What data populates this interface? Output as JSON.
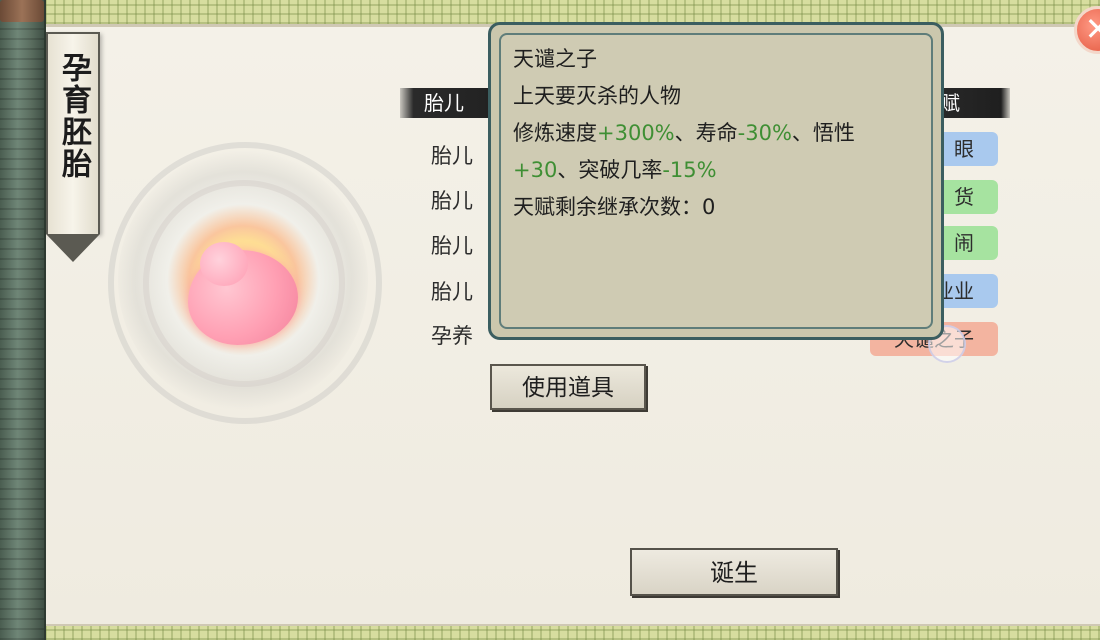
{
  "title": "孕育胚胎",
  "headers": {
    "left_partial": "胎儿",
    "right_partial": "赋"
  },
  "rows": [
    {
      "label_partial": "胎儿"
    },
    {
      "label_partial": "胎儿"
    },
    {
      "label_partial": "胎儿"
    },
    {
      "label_partial": "胎儿"
    },
    {
      "label_partial": "孕养"
    }
  ],
  "talents": [
    {
      "text": "眼",
      "color": "#a9c9ee"
    },
    {
      "text": "货",
      "color": "#a6e3a0"
    },
    {
      "text": "闹",
      "color": "#a6e3a0"
    },
    {
      "text": "业业",
      "color": "#a9c9ee"
    },
    {
      "text": "天谴之子",
      "color": "#f3b4a0"
    }
  ],
  "tooltip": {
    "name": "天谴之子",
    "desc": "上天要灭杀的人物",
    "effects_line1_a": "修炼速度",
    "effects_line1_b": "+300%",
    "effects_line1_c": "、寿命",
    "effects_line1_d": "-30%",
    "effects_line1_e": "、悟性",
    "effects_line2_a": "+30",
    "effects_line2_b": "、突破几率",
    "effects_line2_c": "-15%",
    "inherit": "天赋剩余继承次数：0"
  },
  "buttons": {
    "use_item": "使用道具",
    "birth": "诞生",
    "close": "✕"
  }
}
